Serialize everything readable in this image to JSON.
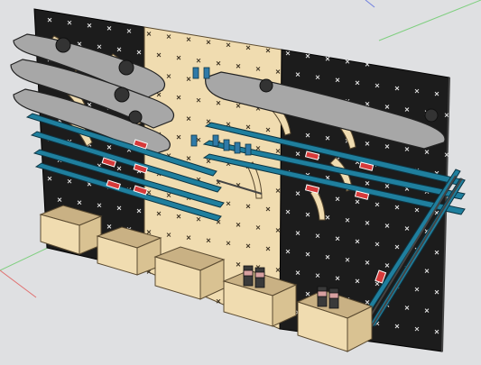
{
  "scene": {
    "subject": "pegboard-ski-rack-3d-model",
    "background_color": "#dfe0e2",
    "panel_color": "#1c1c1c",
    "plywood_color": "#f0dcb0",
    "plywood_edge_color": "#c9b184",
    "ski_color": "#1f7f9e",
    "ski_edge_color": "#b9d6df",
    "snowboard_color": "#a7a7a7",
    "binding_color": "#d63a3a",
    "axis_colors": {
      "green": "#7fcf7f",
      "red": "#e07070",
      "blue": "#7080e0"
    }
  }
}
